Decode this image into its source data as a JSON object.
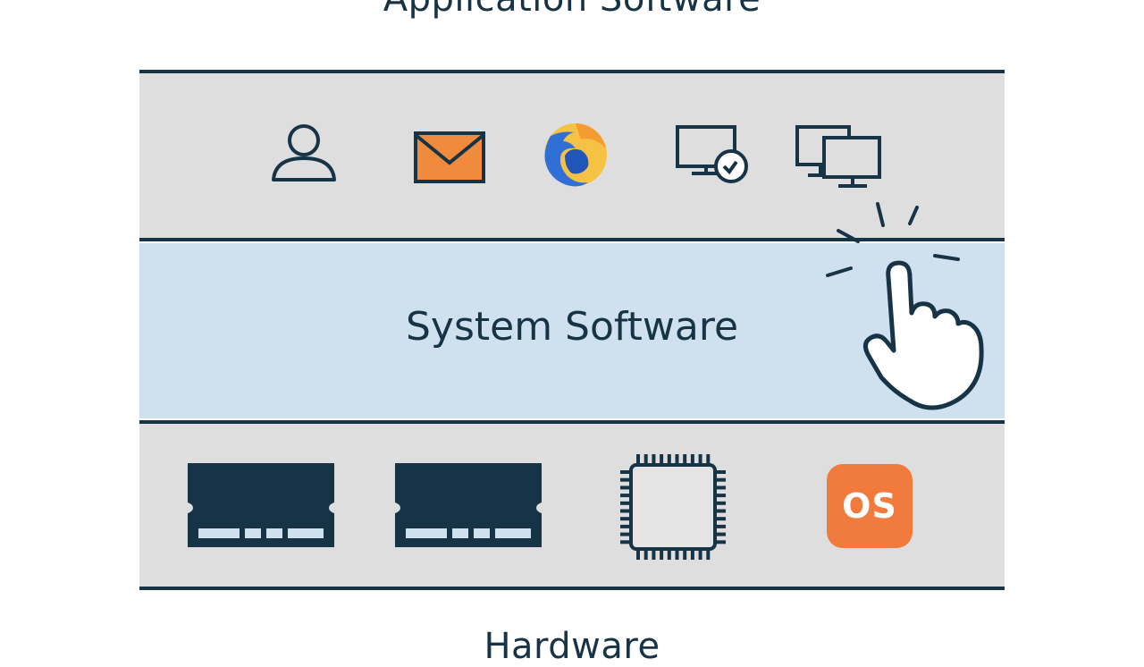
{
  "layers": {
    "top_label": "Application Software",
    "middle_label": "System Software",
    "bottom_label": "Hardware"
  },
  "application_icons": [
    "user-icon",
    "mail-icon",
    "browser-icon",
    "remote-desktop-icon",
    "multi-monitor-icon"
  ],
  "hardware_icons": [
    "ram-module-icon",
    "ram-module-icon",
    "cpu-chip-icon",
    "os-badge-icon"
  ],
  "os_badge": {
    "text": "OS",
    "color": "#f07b3d"
  },
  "colors": {
    "outline": "#173447",
    "app_band": "#dedede",
    "system_band": "#cfe0ee",
    "hardware_band": "#dedede",
    "mail": "#f08a3c"
  }
}
